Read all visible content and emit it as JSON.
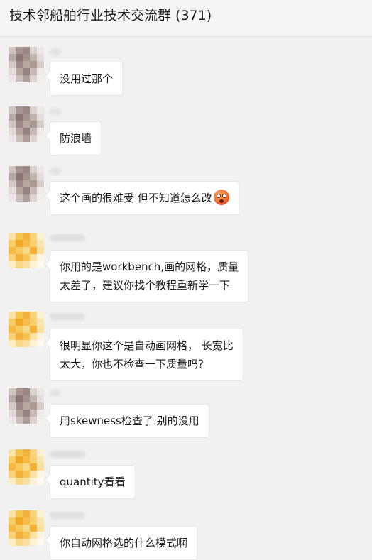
{
  "header": {
    "title": "技术邻船舶行业技术交流群 (371)"
  },
  "messages": [
    {
      "sender": "",
      "text": "没用过那个"
    },
    {
      "sender": "",
      "text": "防浪墙"
    },
    {
      "sender": "",
      "text": "这个画的很难受 但不知道怎么改",
      "emoji": "flushed-face-icon"
    },
    {
      "sender": "",
      "line1": "你用的是workbench,画的网格，质量",
      "line2": "太差了，建议你找个教程重新学一下"
    },
    {
      "sender": "",
      "line1": "很明显你这个是自动画网格， 长宽比",
      "line2": "太大，你也不检查一下质量吗？"
    },
    {
      "sender": "",
      "text": "用skewness检查了 别的没用"
    },
    {
      "sender": "",
      "text": "quantity看看"
    },
    {
      "sender": "",
      "text": "你自动网格选的什么模式啊"
    }
  ],
  "colors": {
    "background": "#f1f1f1",
    "bubble": "#ffffff",
    "avatar_gray": "#a79a96",
    "avatar_yellow": "#f5c04a"
  }
}
